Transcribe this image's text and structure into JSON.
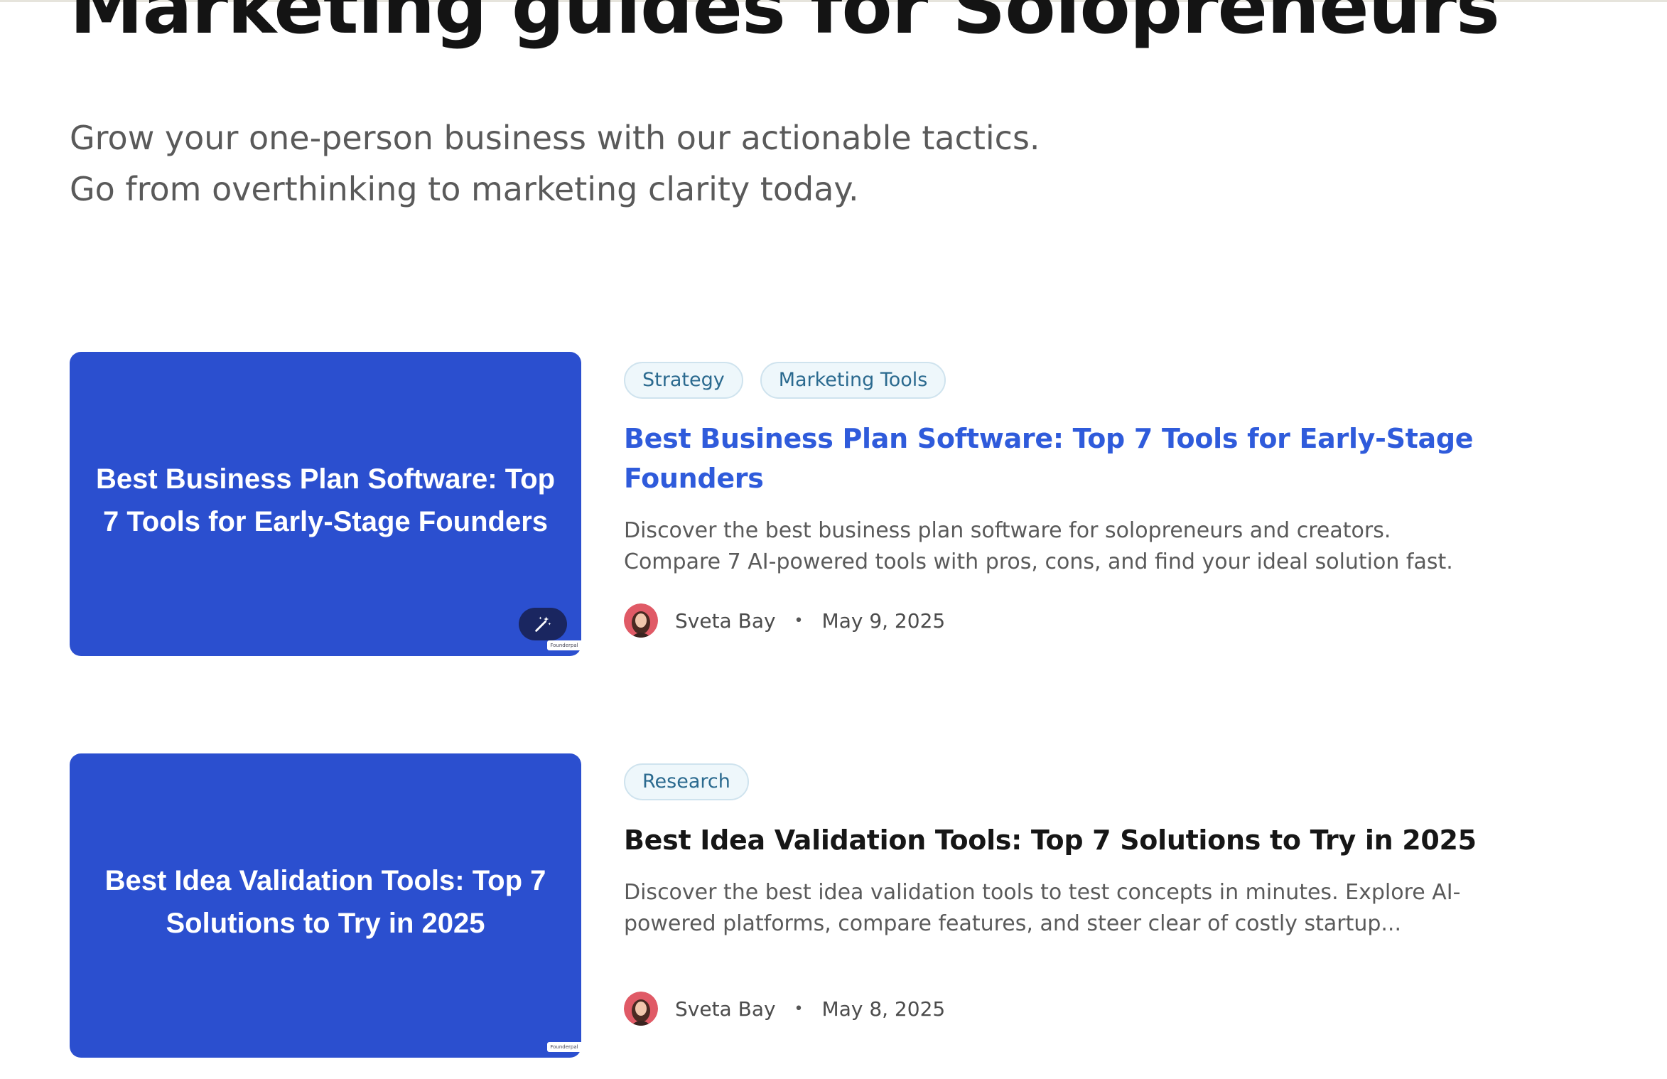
{
  "header": {
    "title": "Marketing guides for Solopreneurs",
    "subtitle_line1": "Grow your one-person business with our actionable tactics.",
    "subtitle_line2": "Go from overthinking to marketing clarity today."
  },
  "posts": [
    {
      "thumbnail_title": "Best Business Plan Software: Top 7 Tools for Early-Stage Founders",
      "tags": [
        "Strategy",
        "Marketing Tools"
      ],
      "title": "Best Business Plan Software: Top 7 Tools for Early-Stage Founders",
      "excerpt": "Discover the best business plan software for solopreneurs and creators. Compare 7 AI-powered tools with pros, cons, and find your ideal solution fast.",
      "author": "Sveta Bay",
      "separator": "•",
      "date": "May 9, 2025",
      "badge_text": "Founderpal",
      "title_color": "#2f5bdb"
    },
    {
      "thumbnail_title": "Best Idea Validation Tools: Top 7 Solutions to Try in 2025",
      "tags": [
        "Research"
      ],
      "title": "Best Idea Validation Tools: Top 7 Solutions to Try in 2025",
      "excerpt": "Discover the best idea validation tools to test concepts in minutes. Explore AI-powered platforms, compare features, and steer clear of costly startup...",
      "author": "Sveta Bay",
      "separator": "•",
      "date": "May 8, 2025",
      "badge_text": "Founderpal",
      "title_color": "#161616"
    }
  ],
  "icons": {
    "magic": "magic-wand-icon",
    "avatar": "author-avatar"
  },
  "colors": {
    "thumbnail_bg": "#2b4fcf",
    "link_blue": "#2f5bdb",
    "tag_bg": "#eef7fb",
    "tag_text": "#2b6a8f"
  }
}
